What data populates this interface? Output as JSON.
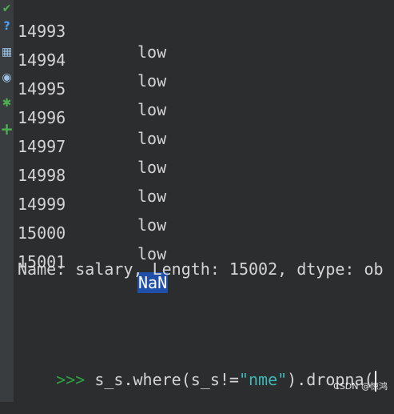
{
  "gutter": {
    "icons": [
      {
        "name": "check-icon",
        "glyph": "✔",
        "color": "#4caf50"
      },
      {
        "name": "help-icon",
        "glyph": "?",
        "color": "#4aa3ff"
      },
      {
        "name": "chart-icon",
        "glyph": "▦",
        "color": "#9ec2e6"
      },
      {
        "name": "profile-icon",
        "glyph": "◉",
        "color": "#9ec2e6"
      },
      {
        "name": "bug-icon",
        "glyph": "✱",
        "color": "#4caf50"
      },
      {
        "name": "add-icon",
        "glyph": "+",
        "color": "#4caf50"
      }
    ]
  },
  "console": {
    "rows": [
      {
        "index": "14993",
        "value": "low"
      },
      {
        "index": "14994",
        "value": "low"
      },
      {
        "index": "14995",
        "value": "low"
      },
      {
        "index": "14996",
        "value": "low"
      },
      {
        "index": "14997",
        "value": "low"
      },
      {
        "index": "14998",
        "value": "low"
      },
      {
        "index": "14999",
        "value": "low"
      },
      {
        "index": "15000",
        "value": "low"
      },
      {
        "index": "15001",
        "value": "NaN"
      }
    ],
    "meta_line": "Name: salary, Length: 15002, dtype: ob",
    "prompt_symbol": ">>>",
    "command_pre": " s_s.where(s_s!=",
    "command_string": "\"nme\"",
    "command_post": ").dropna(",
    "highlight_color": "#1f4fa8"
  },
  "watermark": "CSDN @惊鸿"
}
